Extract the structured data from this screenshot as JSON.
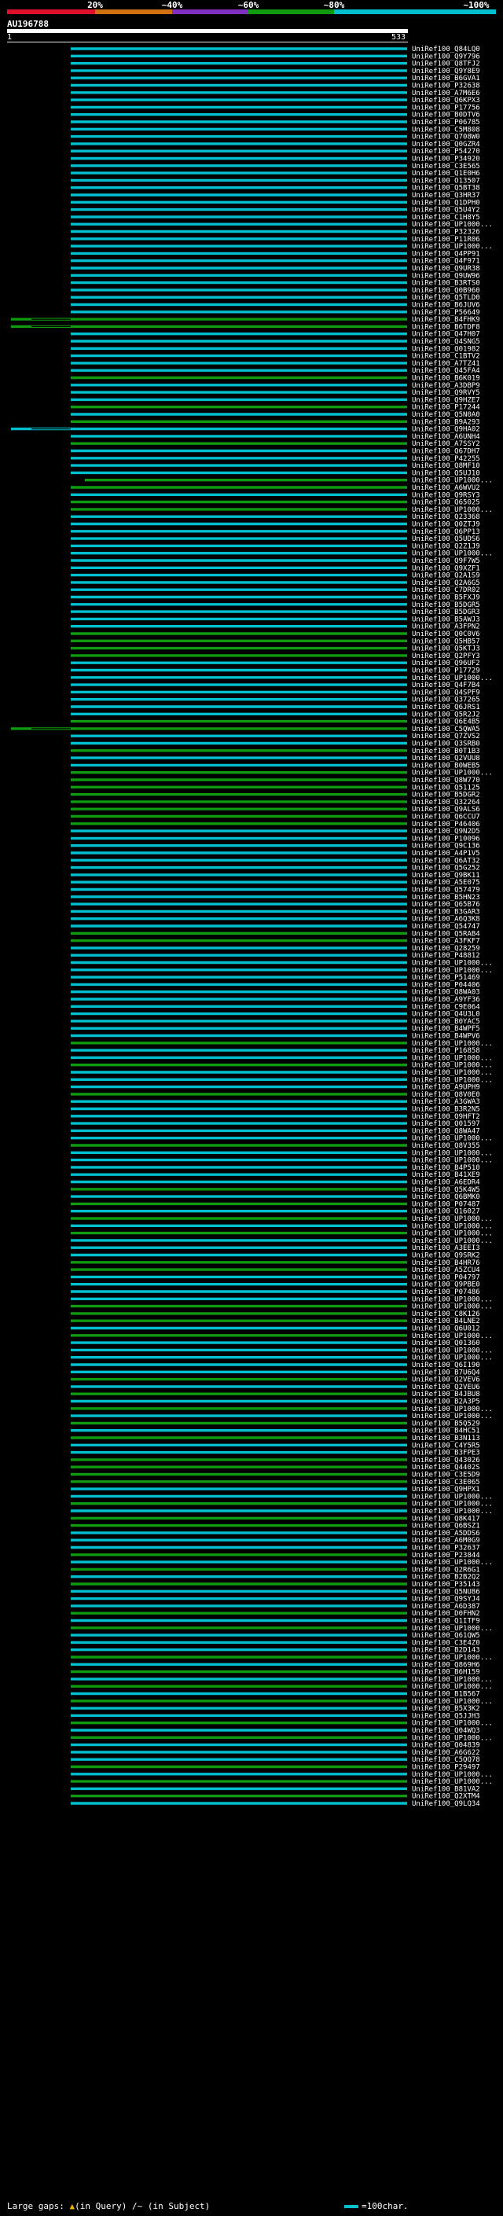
{
  "scale_labels": [
    "20%",
    "~40%",
    "~60%",
    "~80%",
    "~100%"
  ],
  "colors": {
    "identity_20": "#e0102a",
    "identity_40": "#d07010",
    "identity_60": "#8030c0",
    "identity_80": "#109a10",
    "identity_100": "#00c0d0",
    "background": "#000000",
    "query": "#ffffff",
    "gap_marker": "#e8b400"
  },
  "query": {
    "name": "AU196788",
    "start": "1",
    "end": "533"
  },
  "hits": [
    "UniRef100_Q84LQ0",
    "UniRef100_Q9Y796",
    "UniRef100_Q8TFJ2",
    "UniRef100_Q9Y8E9",
    "UniRef100_B6GVA1",
    "UniRef100_P32638",
    "UniRef100_A7M6E6",
    "UniRef100_Q6KPX3",
    "UniRef100_P17756",
    "UniRef100_B0DTV6",
    "UniRef100_P06785",
    "UniRef100_C5M808",
    "UniRef100_Q708W0",
    "UniRef100_Q0GZR4",
    "UniRef100_P54270",
    "UniRef100_P34920",
    "UniRef100_C3E565",
    "UniRef100_Q1E0H6",
    "UniRef100_O13507",
    "UniRef100_Q5BT38",
    "UniRef100_Q3HR37",
    "UniRef100_Q1DPH0",
    "UniRef100_Q5U4Y2",
    "UniRef100_C1H8Y5",
    "UniRef100_UP1000...",
    "UniRef100_P32326",
    "UniRef100_P11R06",
    "UniRef100_UP1000...",
    "UniRef100_Q4PP91",
    "UniRef100_Q4F971",
    "UniRef100_Q9UR38",
    "UniRef100_Q9UW96",
    "UniRef100_B3RTS0",
    "UniRef100_Q0B960",
    "UniRef100_Q5TLD0",
    "UniRef100_B6JUV6",
    "UniRef100_P56649",
    "UniRef100_B4FHK9",
    "UniRef100_B6TDF8",
    "UniRef100_Q47H07",
    "UniRef100_Q4SNG5",
    "UniRef100_Q01982",
    "UniRef100_C1BTV2",
    "UniRef100_A7TZ41",
    "UniRef100_Q45FA4",
    "UniRef100_B6K019",
    "UniRef100_A3DBP9",
    "UniRef100_Q9RVY5",
    "UniRef100_Q9HZE7",
    "UniRef100_P17244",
    "UniRef100_Q5N0A0",
    "UniRef100_B9A293",
    "UniRef100_Q9HA02",
    "UniRef100_A6UNH4",
    "UniRef100_A7SSY2",
    "UniRef100_Q67DH7",
    "UniRef100_P42255",
    "UniRef100_Q8MF10",
    "UniRef100_Q5UJ10",
    "UniRef100_UP1000...",
    "UniRef100_A6WVU2",
    "UniRef100_Q9RSY3",
    "UniRef100_Q65025",
    "UniRef100_UP1000...",
    "UniRef100_Q23368",
    "UniRef100_Q0ZTJ9",
    "UniRef100_Q6PP13",
    "UniRef100_Q5UDS6",
    "UniRef100_Q2Z1J9",
    "UniRef100_UP1000...",
    "UniRef100_Q9F7W5",
    "UniRef100_Q9XZF1",
    "UniRef100_Q2A1S9",
    "UniRef100_Q2A6G5",
    "UniRef100_C7DR02",
    "UniRef100_B5FXJ9",
    "UniRef100_B5DGR5",
    "UniRef100_B5DGR3",
    "UniRef100_B5AWJ3",
    "UniRef100_A3FPN2",
    "UniRef100_Q0C0V6",
    "UniRef100_Q5HB57",
    "UniRef100_Q5KTJ3",
    "UniRef100_Q2PFY3",
    "UniRef100_Q96UF2",
    "UniRef100_P17729",
    "UniRef100_UP1000...",
    "UniRef100_Q4F7B4",
    "UniRef100_Q4SPF9",
    "UniRef100_Q37265",
    "UniRef100_Q6JRS1",
    "UniRef100_Q5R2J2",
    "UniRef100_Q6E4B5",
    "UniRef100_C5QWA5",
    "UniRef100_Q7ZVS2",
    "UniRef100_Q3SRB0",
    "UniRef100_B0T1B3",
    "UniRef100_Q2VUU8",
    "UniRef100_B0WEB5",
    "UniRef100_UP1000...",
    "UniRef100_Q8W770",
    "UniRef100_Q51125",
    "UniRef100_B5DGR2",
    "UniRef100_Q32264",
    "UniRef100_Q9ALS6",
    "UniRef100_Q6CCU7",
    "UniRef100_P46406",
    "UniRef100_Q9N2D5",
    "UniRef100_P10096",
    "UniRef100_Q9C136",
    "UniRef100_A4P1V5",
    "UniRef100_Q6AT32",
    "UniRef100_Q5G252",
    "UniRef100_Q9BK11",
    "UniRef100_A5E075",
    "UniRef100_Q57479",
    "UniRef100_B5HN23",
    "UniRef100_Q65B76",
    "UniRef100_B3GAR3",
    "UniRef100_A6Q3K8",
    "UniRef100_Q54747",
    "UniRef100_Q5RAB4",
    "UniRef100_A3FKF7",
    "UniRef100_Q28259",
    "UniRef100_P48812",
    "UniRef100_UP1000...",
    "UniRef100_UP1000...",
    "UniRef100_P51469",
    "UniRef100_P04406",
    "UniRef100_Q8WA03",
    "UniRef100_A9YF36",
    "UniRef100_C9E064",
    "UniRef100_Q4U3L0",
    "UniRef100_B0YAC5",
    "UniRef100_B4WPF5",
    "UniRef100_B4WPV6",
    "UniRef100_UP1000...",
    "UniRef100_P16858",
    "UniRef100_UP1000...",
    "UniRef100_UP1000...",
    "UniRef100_UP1000...",
    "UniRef100_UP1000...",
    "UniRef100_A9UPH9",
    "UniRef100_Q8V0E0",
    "UniRef100_A3GWA3",
    "UniRef100_B3R2N5",
    "UniRef100_Q9HFT2",
    "UniRef100_Q01597",
    "UniRef100_Q8WA47",
    "UniRef100_UP1000...",
    "UniRef100_Q8V355",
    "UniRef100_UP1000...",
    "UniRef100_UP1000...",
    "UniRef100_B4P510",
    "UniRef100_B41XE9",
    "UniRef100_A6EDR4",
    "UniRef100_Q5K4W5",
    "UniRef100_Q6BMK0",
    "UniRef100_P07487",
    "UniRef100_Q16027",
    "UniRef100_UP1000...",
    "UniRef100_UP1000...",
    "UniRef100_UP1000...",
    "UniRef100_UP1000...",
    "UniRef100_A3EEI3",
    "UniRef100_Q9SRK2",
    "UniRef100_B4HR76",
    "UniRef100_A5ZCU4",
    "UniRef100_P04797",
    "UniRef100_Q9PBE0",
    "UniRef100_P07486",
    "UniRef100_UP1000...",
    "UniRef100_UP1000...",
    "UniRef100_C8K126",
    "UniRef100_B4LNE2",
    "UniRef100_Q6U012",
    "UniRef100_UP1000...",
    "UniRef100_Q01360",
    "UniRef100_UP1000...",
    "UniRef100_UP1000...",
    "UniRef100_Q6I190",
    "UniRef100_B7U6Q4",
    "UniRef100_Q2VEV6",
    "UniRef100_Q2VEU6",
    "UniRef100_B4JBU8",
    "UniRef100_B2A3P5",
    "UniRef100_UP1000...",
    "UniRef100_UP1000...",
    "UniRef100_B5Q529",
    "UniRef100_B4HC51",
    "UniRef100_B3N113",
    "UniRef100_C4Y5R5",
    "UniRef100_B3FPE3",
    "UniRef100_Q43026",
    "UniRef100_Q4402S",
    "UniRef100_C3E5D9",
    "UniRef100_C3E065",
    "UniRef100_Q9HPX1",
    "UniRef100_UP1000...",
    "UniRef100_UP1000...",
    "UniRef100_UP1000...",
    "UniRef100_Q8K417",
    "UniRef100_Q6BSZ1",
    "UniRef100_A5DDS6",
    "UniRef100_A6M0G9",
    "UniRef100_P32637",
    "UniRef100_P23844",
    "UniRef100_UP1000...",
    "UniRef100_Q2R6G1",
    "UniRef100_B2B2Q2",
    "UniRef100_P35143",
    "UniRef100_Q5NU86",
    "UniRef100_Q9SYJ4",
    "UniRef100_A6D387",
    "UniRef100_D0FHN2",
    "UniRef100_Q1ITF9",
    "UniRef100_UP1000...",
    "UniRef100_Q61QW5",
    "UniRef100_C3E4Z0",
    "UniRef100_B2D143",
    "UniRef100_UP1000...",
    "UniRef100_Q869H6",
    "UniRef100_B6H159",
    "UniRef100_UP1000...",
    "UniRef100_UP1000...",
    "UniRef100_B1B567",
    "UniRef100_UP1000...",
    "UniRef100_B5X3K2",
    "UniRef100_Q5JJH3",
    "UniRef100_UP1000...",
    "UniRef100_Q04WQ3",
    "UniRef100_UP1000...",
    "UniRef100_Q04839",
    "UniRef100_A6G622",
    "UniRef100_C5QQ78",
    "UniRef100_P29497",
    "UniRef100_UP1000...",
    "UniRef100_UP1000...",
    "UniRef100_B81VA2",
    "UniRef100_Q2XTM4",
    "UniRef100_Q9LQ34"
  ],
  "legend": {
    "large_gaps_label": "Large gaps:",
    "in_query": "(in Query)",
    "in_subject": "/~ (in Subject)",
    "scale_text": "=100char."
  }
}
